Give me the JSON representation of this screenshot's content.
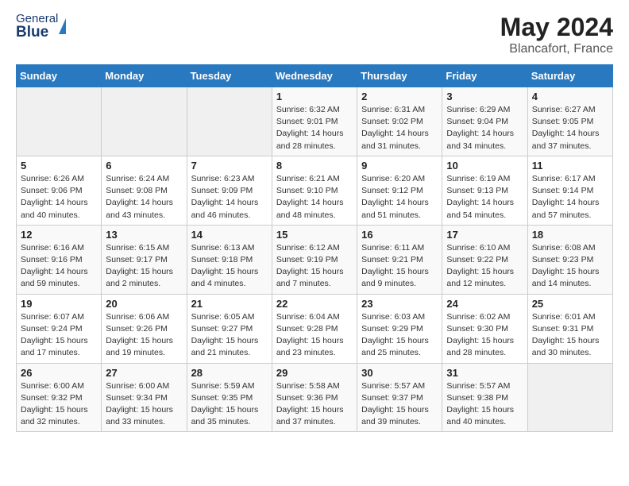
{
  "header": {
    "logo_general": "General",
    "logo_blue": "Blue",
    "month_year": "May 2024",
    "location": "Blancafort, France"
  },
  "days_of_week": [
    "Sunday",
    "Monday",
    "Tuesday",
    "Wednesday",
    "Thursday",
    "Friday",
    "Saturday"
  ],
  "weeks": [
    [
      {
        "day": "",
        "info": ""
      },
      {
        "day": "",
        "info": ""
      },
      {
        "day": "",
        "info": ""
      },
      {
        "day": "1",
        "info": "Sunrise: 6:32 AM\nSunset: 9:01 PM\nDaylight: 14 hours\nand 28 minutes."
      },
      {
        "day": "2",
        "info": "Sunrise: 6:31 AM\nSunset: 9:02 PM\nDaylight: 14 hours\nand 31 minutes."
      },
      {
        "day": "3",
        "info": "Sunrise: 6:29 AM\nSunset: 9:04 PM\nDaylight: 14 hours\nand 34 minutes."
      },
      {
        "day": "4",
        "info": "Sunrise: 6:27 AM\nSunset: 9:05 PM\nDaylight: 14 hours\nand 37 minutes."
      }
    ],
    [
      {
        "day": "5",
        "info": "Sunrise: 6:26 AM\nSunset: 9:06 PM\nDaylight: 14 hours\nand 40 minutes."
      },
      {
        "day": "6",
        "info": "Sunrise: 6:24 AM\nSunset: 9:08 PM\nDaylight: 14 hours\nand 43 minutes."
      },
      {
        "day": "7",
        "info": "Sunrise: 6:23 AM\nSunset: 9:09 PM\nDaylight: 14 hours\nand 46 minutes."
      },
      {
        "day": "8",
        "info": "Sunrise: 6:21 AM\nSunset: 9:10 PM\nDaylight: 14 hours\nand 48 minutes."
      },
      {
        "day": "9",
        "info": "Sunrise: 6:20 AM\nSunset: 9:12 PM\nDaylight: 14 hours\nand 51 minutes."
      },
      {
        "day": "10",
        "info": "Sunrise: 6:19 AM\nSunset: 9:13 PM\nDaylight: 14 hours\nand 54 minutes."
      },
      {
        "day": "11",
        "info": "Sunrise: 6:17 AM\nSunset: 9:14 PM\nDaylight: 14 hours\nand 57 minutes."
      }
    ],
    [
      {
        "day": "12",
        "info": "Sunrise: 6:16 AM\nSunset: 9:16 PM\nDaylight: 14 hours\nand 59 minutes."
      },
      {
        "day": "13",
        "info": "Sunrise: 6:15 AM\nSunset: 9:17 PM\nDaylight: 15 hours\nand 2 minutes."
      },
      {
        "day": "14",
        "info": "Sunrise: 6:13 AM\nSunset: 9:18 PM\nDaylight: 15 hours\nand 4 minutes."
      },
      {
        "day": "15",
        "info": "Sunrise: 6:12 AM\nSunset: 9:19 PM\nDaylight: 15 hours\nand 7 minutes."
      },
      {
        "day": "16",
        "info": "Sunrise: 6:11 AM\nSunset: 9:21 PM\nDaylight: 15 hours\nand 9 minutes."
      },
      {
        "day": "17",
        "info": "Sunrise: 6:10 AM\nSunset: 9:22 PM\nDaylight: 15 hours\nand 12 minutes."
      },
      {
        "day": "18",
        "info": "Sunrise: 6:08 AM\nSunset: 9:23 PM\nDaylight: 15 hours\nand 14 minutes."
      }
    ],
    [
      {
        "day": "19",
        "info": "Sunrise: 6:07 AM\nSunset: 9:24 PM\nDaylight: 15 hours\nand 17 minutes."
      },
      {
        "day": "20",
        "info": "Sunrise: 6:06 AM\nSunset: 9:26 PM\nDaylight: 15 hours\nand 19 minutes."
      },
      {
        "day": "21",
        "info": "Sunrise: 6:05 AM\nSunset: 9:27 PM\nDaylight: 15 hours\nand 21 minutes."
      },
      {
        "day": "22",
        "info": "Sunrise: 6:04 AM\nSunset: 9:28 PM\nDaylight: 15 hours\nand 23 minutes."
      },
      {
        "day": "23",
        "info": "Sunrise: 6:03 AM\nSunset: 9:29 PM\nDaylight: 15 hours\nand 25 minutes."
      },
      {
        "day": "24",
        "info": "Sunrise: 6:02 AM\nSunset: 9:30 PM\nDaylight: 15 hours\nand 28 minutes."
      },
      {
        "day": "25",
        "info": "Sunrise: 6:01 AM\nSunset: 9:31 PM\nDaylight: 15 hours\nand 30 minutes."
      }
    ],
    [
      {
        "day": "26",
        "info": "Sunrise: 6:00 AM\nSunset: 9:32 PM\nDaylight: 15 hours\nand 32 minutes."
      },
      {
        "day": "27",
        "info": "Sunrise: 6:00 AM\nSunset: 9:34 PM\nDaylight: 15 hours\nand 33 minutes."
      },
      {
        "day": "28",
        "info": "Sunrise: 5:59 AM\nSunset: 9:35 PM\nDaylight: 15 hours\nand 35 minutes."
      },
      {
        "day": "29",
        "info": "Sunrise: 5:58 AM\nSunset: 9:36 PM\nDaylight: 15 hours\nand 37 minutes."
      },
      {
        "day": "30",
        "info": "Sunrise: 5:57 AM\nSunset: 9:37 PM\nDaylight: 15 hours\nand 39 minutes."
      },
      {
        "day": "31",
        "info": "Sunrise: 5:57 AM\nSunset: 9:38 PM\nDaylight: 15 hours\nand 40 minutes."
      },
      {
        "day": "",
        "info": ""
      }
    ]
  ]
}
